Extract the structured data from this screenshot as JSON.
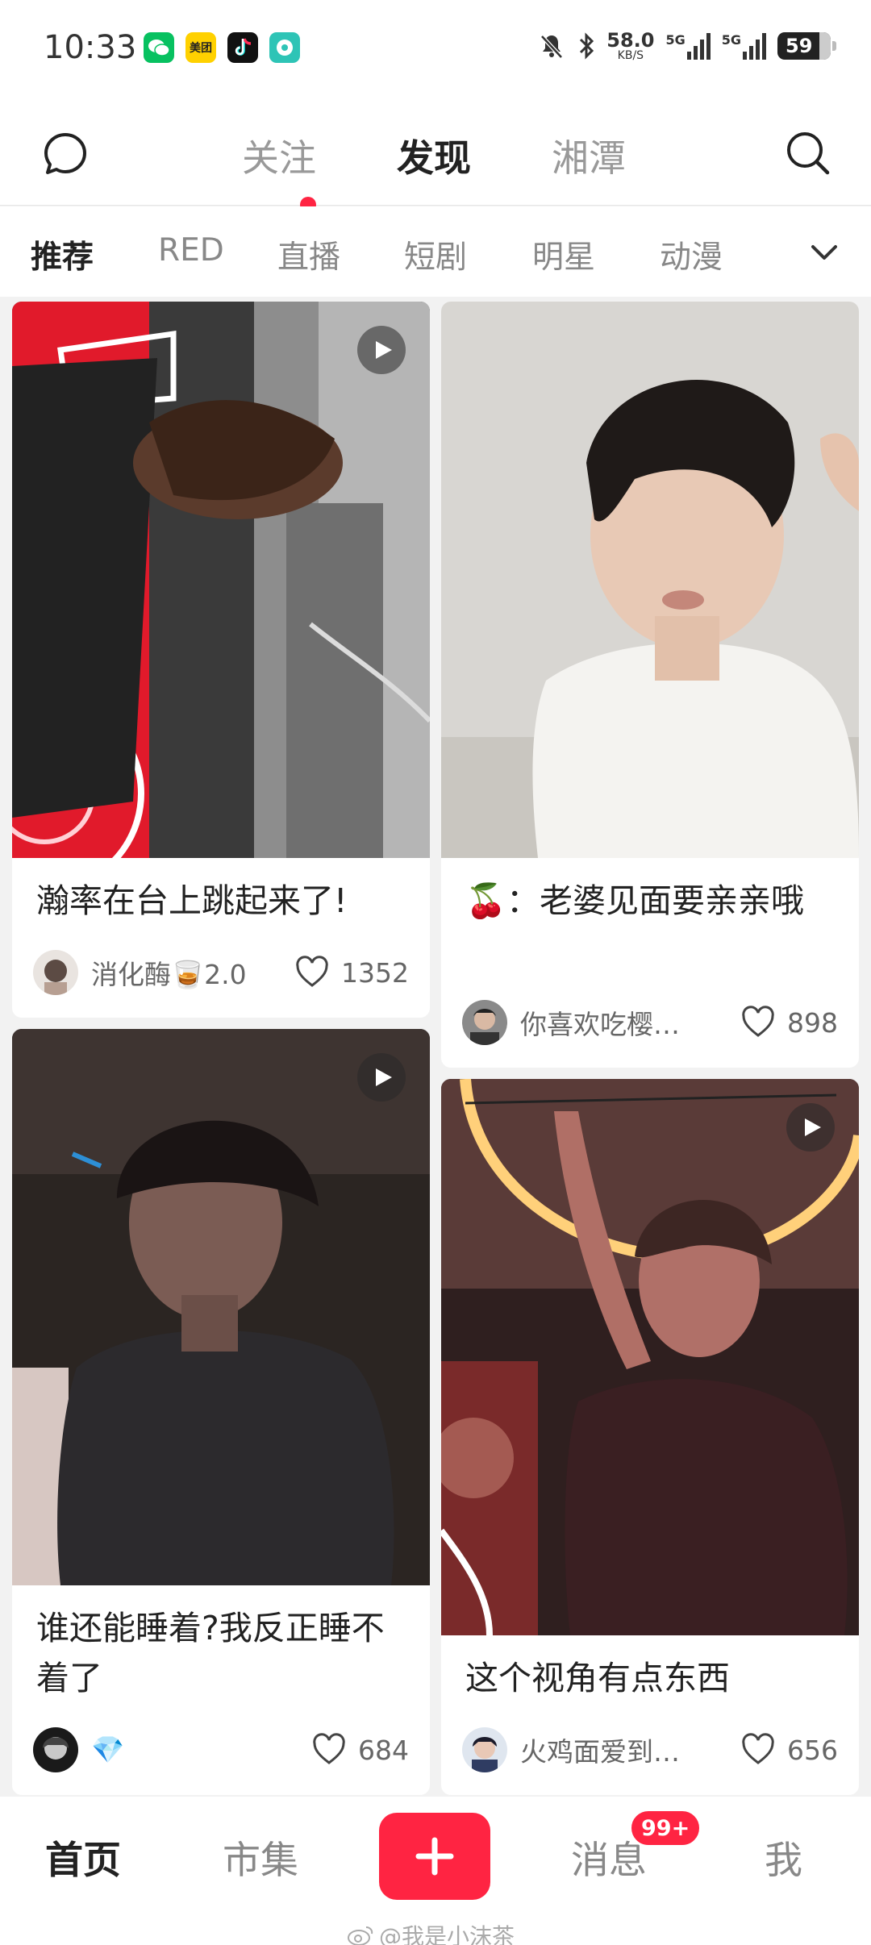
{
  "status_bar": {
    "time": "10:33",
    "apps": [
      {
        "icon": "wechat-icon",
        "color": "#07c160",
        "label": ""
      },
      {
        "icon": "meituan-icon",
        "color": "#ffd100",
        "label": "美团"
      },
      {
        "icon": "douyin-icon",
        "color": "#111111",
        "label": ""
      },
      {
        "icon": "chat-bubble-app-icon",
        "color": "#2ec4b6",
        "label": ""
      }
    ],
    "net_speed": "58.0",
    "net_speed_unit": "KB/S",
    "signal_1_label": "5G",
    "signal_2_label": "5G",
    "battery": "59"
  },
  "top_nav": {
    "tabs": [
      {
        "label": "关注",
        "active": false
      },
      {
        "label": "发现",
        "active": true
      },
      {
        "label": "湘潭",
        "active": false
      }
    ]
  },
  "categories": [
    {
      "label": "推荐",
      "active": true
    },
    {
      "label": "RED",
      "active": false
    },
    {
      "label": "直播",
      "active": false
    },
    {
      "label": "短剧",
      "active": false
    },
    {
      "label": "明星",
      "active": false
    },
    {
      "label": "动漫",
      "active": false
    }
  ],
  "feed": [
    {
      "title": "瀚率在台上跳起来了!",
      "author": "消化酶🥃2.0",
      "likes": "1352",
      "video": true
    },
    {
      "title": "🍒：老婆见面要亲亲哦",
      "author": "你喜欢吃樱…",
      "likes": "898",
      "video": false
    },
    {
      "title": "谁还能睡着?我反正睡不着了",
      "author": "💎",
      "likes": "684",
      "video": true
    },
    {
      "title": "这个视角有点东西",
      "author": "火鸡面爱到…",
      "likes": "656",
      "video": true
    }
  ],
  "bottom_nav": {
    "home": "首页",
    "market": "市集",
    "messages": "消息",
    "messages_badge": "99+",
    "me": "我"
  },
  "watermark": "@我是小沫茶",
  "colors": {
    "accent": "#ff2442",
    "text_primary": "#222222",
    "text_secondary": "#888888"
  }
}
